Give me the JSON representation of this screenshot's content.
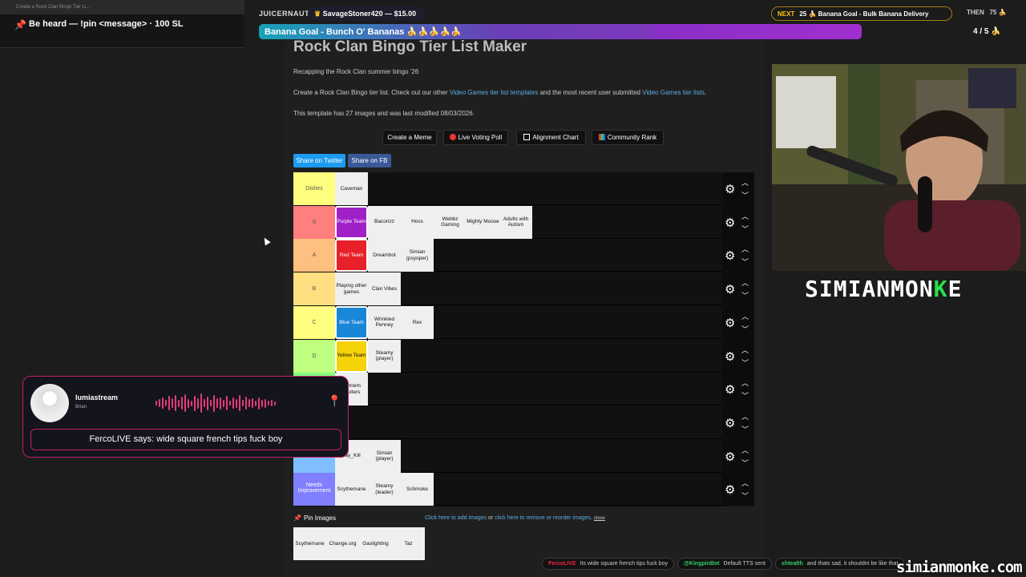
{
  "browser_tab": {
    "title": "Create a Rock Clan Bingo Tier Li..."
  },
  "pin_bar": {
    "text": "Be heard — !pin <message> · 100 SL"
  },
  "overlay": {
    "latest_sub_label": "JUICERNAUT",
    "latest_sub": "SavageStoner420 — $15.00",
    "goal": "Banana Goal - Bunch O' Bananas 🍌🍌🍌🍌🍌",
    "next_label": "NEXT",
    "next_value": "25 🍌 Banana Goal - Bulk Banana Delivery",
    "then_label": "THEN",
    "then_value": "75 🍌",
    "progress": "4 / 5 🍌",
    "goal_fraction": 0.8
  },
  "page": {
    "title": "Rock Clan Bingo Tier List Maker",
    "subtitle": "Recapping the Rock Clan summer bingo '26",
    "intro_before": "Create a Rock Clan Bingo tier list. Check out our other ",
    "intro_link1": "Video Games tier list templates",
    "intro_mid": " and the most recent user submitted ",
    "intro_link2": "Video Games tier lists",
    "intro_after": ".",
    "info": "This template has 27 images and was last modified 08/03/2026.",
    "buttons": {
      "meme": "Create a Meme",
      "poll": "Live Voting Poll",
      "alignment": "Alignment Chart",
      "community": "Community Rank"
    },
    "share_twitter": "Share on Twitter",
    "share_fb": "Share on FB",
    "pin_images": "Pin Images",
    "add_images": "Click here to add images",
    "or": " or ",
    "remove_images": "click here to remove or reorder images",
    "close": "close"
  },
  "tiers": [
    {
      "label": "Dishes",
      "color": "#ffff7f",
      "items": [
        {
          "text": "Caveman"
        }
      ]
    },
    {
      "label": "S",
      "color": "#ff7f7f",
      "items": [
        {
          "text": "Purple Team",
          "bg": "#a020c8",
          "fg": "#fff"
        },
        {
          "text": "Baconzz"
        },
        {
          "text": "Hoss"
        },
        {
          "text": "Webbz Gaming"
        },
        {
          "text": "Mighty Moose"
        },
        {
          "text": "Adults with Autism"
        }
      ]
    },
    {
      "label": "A",
      "color": "#ffbf7f",
      "items": [
        {
          "text": "Red Team",
          "bg": "#e8202a",
          "fg": "#fff"
        },
        {
          "text": "Dreambot"
        },
        {
          "text": "Simian (psyoper)"
        }
      ]
    },
    {
      "label": "B",
      "color": "#ffdf7f",
      "items": [
        {
          "text": "Playing other games"
        },
        {
          "text": "Clan Vibes"
        }
      ]
    },
    {
      "label": "C",
      "color": "#ffff7f",
      "items": [
        {
          "text": "Blue Team",
          "bg": "#1a86d8",
          "fg": "#fff"
        },
        {
          "text": "Wrinkled Penney"
        },
        {
          "text": "Rex"
        }
      ]
    },
    {
      "label": "D",
      "color": "#bfff7f",
      "items": [
        {
          "text": "Yellow Team",
          "bg": "#f5d20a",
          "fg": "#111"
        },
        {
          "text": "Steamy (player)"
        }
      ]
    },
    {
      "label": "",
      "color": "#7fff7f",
      "items": [
        {
          "text": "Nutnem Fruiters"
        }
      ]
    },
    {
      "label": "",
      "color": "#7fffff",
      "items": []
    },
    {
      "label": "Action",
      "color": "#7fbfff",
      "items": [
        {
          "text": "Jay_Kill"
        },
        {
          "text": "Simian (player)"
        }
      ]
    },
    {
      "label": "Needs Improvement",
      "color": "#7f7fff",
      "items": [
        {
          "text": "Scythemane"
        },
        {
          "text": "Steamy (leader)"
        },
        {
          "text": "Schmoke"
        }
      ]
    }
  ],
  "pool": [
    {
      "text": "Scythemane"
    },
    {
      "text": "Change.org"
    },
    {
      "text": "Gaslighting"
    },
    {
      "text": "Taz"
    }
  ],
  "webcam": {
    "brand_part1": "SIMIANMON",
    "brand_part2": "K",
    "brand_part3": "E"
  },
  "tts": {
    "name": "lumiastream",
    "sub": "Brian",
    "message": "FercoLIVE says: wide square french tips fuck boy",
    "accent": "#c21d6a"
  },
  "ticker": [
    {
      "user": "FercoLIVE",
      "text": "Its wide square french tips fuck boy"
    },
    {
      "user": "@KingpinBot",
      "text": "Default TTS sent"
    },
    {
      "user": "shtealth",
      "text": "and thats sad, it shouldnt be like that"
    }
  ],
  "site": "simianmonke.com"
}
